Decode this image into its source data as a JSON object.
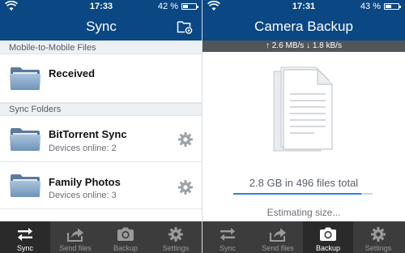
{
  "left_screen": {
    "status": {
      "time": "17:33",
      "battery": "42 %",
      "battery_level": 0.42
    },
    "nav": {
      "title": "Sync"
    },
    "sections": {
      "mobile": "Mobile-to-Mobile Files",
      "sync_folders": "Sync Folders"
    },
    "rows": [
      {
        "name": "Received"
      },
      {
        "name": "BitTorrent Sync",
        "sub": "Devices online: 2"
      },
      {
        "name": "Family Photos",
        "sub": "Devices online: 3"
      }
    ],
    "tabs": [
      {
        "label": "Sync",
        "icon": "sync-icon",
        "active": true
      },
      {
        "label": "Send files",
        "icon": "share-icon",
        "active": false
      },
      {
        "label": "Backup",
        "icon": "camera-icon",
        "active": false
      },
      {
        "label": "Settings",
        "icon": "gear-icon",
        "active": false
      }
    ]
  },
  "right_screen": {
    "status": {
      "time": "17:31",
      "battery": "43 %",
      "battery_level": 0.43
    },
    "nav": {
      "title": "Camera Backup"
    },
    "speed": "↑ 2.6 MB/s ↓ 1.8 kB/s",
    "total": "2.8 GB in 496 files total",
    "progress": 0.92,
    "estimating": "Estimating size...",
    "tabs": [
      {
        "label": "Sync",
        "icon": "sync-icon",
        "active": false
      },
      {
        "label": "Send files",
        "icon": "share-icon",
        "active": false
      },
      {
        "label": "Backup",
        "icon": "camera-icon",
        "active": true
      },
      {
        "label": "Settings",
        "icon": "gear-icon",
        "active": false
      }
    ]
  },
  "colors": {
    "nav_blue": "#0a4783",
    "tabbar": "#3c3c3c",
    "tab_active": "#2a2a2a",
    "progress": "#2d83dd",
    "speedbar": "#525659"
  }
}
